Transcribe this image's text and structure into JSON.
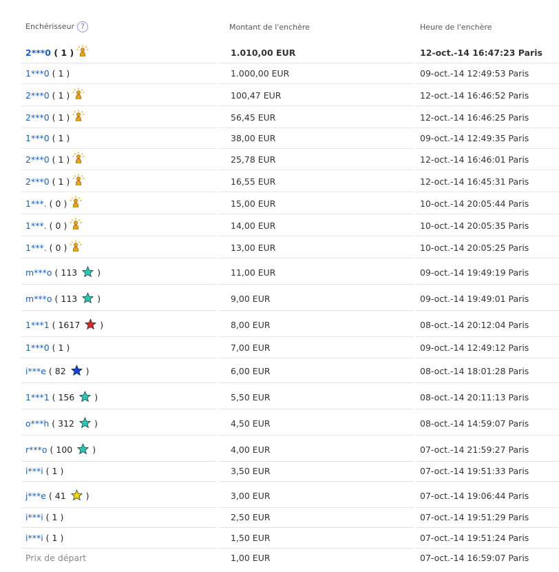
{
  "headers": {
    "bidder": "Enchérisseur",
    "amount": "Montant de l'enchère",
    "time": "Heure de l'enchère",
    "help_glyph": "?"
  },
  "colors": {
    "link": "#1a5fb4",
    "star_turquoise": "#2ec4b6",
    "star_red": "#d62828",
    "star_blue": "#1d3fd6",
    "star_yellow": "#f5d30f",
    "newbie_icon": "#e8a317"
  },
  "bids": [
    {
      "bidder": "2***0",
      "score": "1",
      "icon": "newbie-icon",
      "amount": "1.010,00 EUR",
      "time": "12-oct.-14 16:47:23 Paris",
      "top": true
    },
    {
      "bidder": "1***0",
      "score": "1",
      "icon": "",
      "amount": "1.000,00 EUR",
      "time": "09-oct.-14 12:49:53 Paris"
    },
    {
      "bidder": "2***0",
      "score": "1",
      "icon": "newbie-icon",
      "amount": "100,47 EUR",
      "time": "12-oct.-14 16:46:52 Paris"
    },
    {
      "bidder": "2***0",
      "score": "1",
      "icon": "newbie-icon",
      "amount": "56,45 EUR",
      "time": "12-oct.-14 16:46:25 Paris"
    },
    {
      "bidder": "1***0",
      "score": "1",
      "icon": "",
      "amount": "38,00 EUR",
      "time": "09-oct.-14 12:49:35 Paris"
    },
    {
      "bidder": "2***0",
      "score": "1",
      "icon": "newbie-icon",
      "amount": "25,78 EUR",
      "time": "12-oct.-14 16:46:01 Paris"
    },
    {
      "bidder": "2***0",
      "score": "1",
      "icon": "newbie-icon",
      "amount": "16,55 EUR",
      "time": "12-oct.-14 16:45:31 Paris"
    },
    {
      "bidder": "1***.",
      "score": "0",
      "icon": "newbie-icon",
      "amount": "15,00 EUR",
      "time": "10-oct.-14 20:05:44 Paris"
    },
    {
      "bidder": "1***.",
      "score": "0",
      "icon": "newbie-icon",
      "amount": "14,00 EUR",
      "time": "10-oct.-14 20:05:35 Paris"
    },
    {
      "bidder": "1***.",
      "score": "0",
      "icon": "newbie-icon",
      "amount": "13,00 EUR",
      "time": "10-oct.-14 20:05:25 Paris"
    },
    {
      "bidder": "m***o",
      "score": "113",
      "icon": "turquoise-star-icon",
      "amount": "11,00 EUR",
      "time": "09-oct.-14 19:49:19 Paris"
    },
    {
      "bidder": "m***o",
      "score": "113",
      "icon": "turquoise-star-icon",
      "amount": "9,00 EUR",
      "time": "09-oct.-14 19:49:01 Paris"
    },
    {
      "bidder": "1***1",
      "score": "1617",
      "icon": "red-star-icon",
      "amount": "8,00 EUR",
      "time": "08-oct.-14 20:12:04 Paris"
    },
    {
      "bidder": "1***0",
      "score": "1",
      "icon": "",
      "amount": "7,00 EUR",
      "time": "09-oct.-14 12:49:12 Paris"
    },
    {
      "bidder": "i***e",
      "score": "82",
      "icon": "blue-star-icon",
      "amount": "6,00 EUR",
      "time": "08-oct.-14 18:01:28 Paris"
    },
    {
      "bidder": "1***1",
      "score": "156",
      "icon": "turquoise-star-icon",
      "amount": "5,50 EUR",
      "time": "08-oct.-14 20:11:13 Paris"
    },
    {
      "bidder": "o***h",
      "score": "312",
      "icon": "turquoise-star-icon",
      "amount": "4,50 EUR",
      "time": "08-oct.-14 14:59:07 Paris"
    },
    {
      "bidder": "r***o",
      "score": "100",
      "icon": "turquoise-star-icon",
      "amount": "4,00 EUR",
      "time": "07-oct.-14 21:59:27 Paris"
    },
    {
      "bidder": "i***i",
      "score": "1",
      "icon": "",
      "amount": "3,50 EUR",
      "time": "07-oct.-14 19:51:33 Paris"
    },
    {
      "bidder": "j***e",
      "score": "41",
      "icon": "yellow-star-icon",
      "amount": "3,00 EUR",
      "time": "07-oct.-14 19:06:44 Paris"
    },
    {
      "bidder": "i***i",
      "score": "1",
      "icon": "",
      "amount": "2,50 EUR",
      "time": "07-oct.-14 19:51:29 Paris"
    },
    {
      "bidder": "i***i",
      "score": "1",
      "icon": "",
      "amount": "1,50 EUR",
      "time": "07-oct.-14 19:51:24 Paris"
    }
  ],
  "start": {
    "label": "Prix de départ",
    "amount": "1,00 EUR",
    "time": "07-oct.-14 16:59:07 Paris"
  }
}
